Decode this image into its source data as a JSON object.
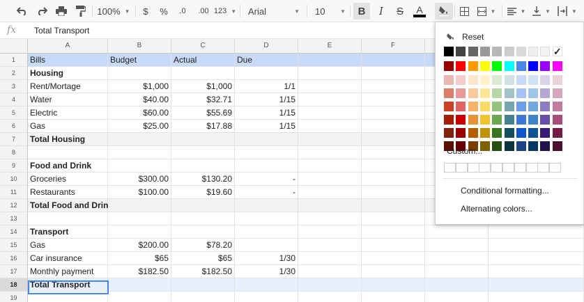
{
  "toolbar": {
    "zoom": "100%",
    "currency": "$",
    "percent": "%",
    "decrease_decimal": ".0",
    "increase_decimal": ".00",
    "number_format": "123",
    "font": "Arial",
    "font_size": "10",
    "bold": "B",
    "italic": "I",
    "strikethrough": "S",
    "text_color": "A",
    "text_color_value": "#000000",
    "icons": [
      "undo-icon",
      "redo-icon",
      "print-icon",
      "paint-format-icon",
      "fill-color-icon",
      "borders-icon",
      "merge-cells-icon",
      "horizontal-align-icon",
      "vertical-align-icon",
      "text-rotation-icon"
    ]
  },
  "formula_bar": {
    "fx": "fx",
    "value": "Total Transport"
  },
  "columns": [
    "A",
    "B",
    "C",
    "D",
    "E",
    "F"
  ],
  "rows": [
    {
      "num": "1",
      "style": "hdr",
      "cells": [
        "Bills",
        "Budget",
        "Actual",
        "Due",
        "",
        ""
      ]
    },
    {
      "num": "2",
      "style": "",
      "cells": [
        "Housing",
        "",
        "",
        "",
        "",
        ""
      ],
      "bold_first": true
    },
    {
      "num": "3",
      "style": "",
      "cells": [
        "Rent/Mortage",
        "$1,000",
        "$1,000",
        "1/1",
        "",
        ""
      ]
    },
    {
      "num": "4",
      "style": "",
      "cells": [
        "Water",
        "$40.00",
        "$32.71",
        "1/15",
        "",
        ""
      ]
    },
    {
      "num": "5",
      "style": "",
      "cells": [
        "Electric",
        "$60.00",
        "$55.69",
        "1/15",
        "",
        ""
      ]
    },
    {
      "num": "6",
      "style": "",
      "cells": [
        "Gas",
        "$25.00",
        "$17.88",
        "1/15",
        "",
        ""
      ]
    },
    {
      "num": "7",
      "style": "tot",
      "cells": [
        "Total Housing",
        "",
        "",
        "",
        "",
        ""
      ],
      "bold_first": true
    },
    {
      "num": "8",
      "style": "",
      "cells": [
        "",
        "",
        "",
        "",
        "",
        ""
      ]
    },
    {
      "num": "9",
      "style": "",
      "cells": [
        "Food and Drink",
        "",
        "",
        "",
        "",
        ""
      ],
      "bold_first": true
    },
    {
      "num": "10",
      "style": "",
      "cells": [
        "Groceries",
        "$300.00",
        "$130.20",
        "-",
        "",
        ""
      ]
    },
    {
      "num": "11",
      "style": "",
      "cells": [
        "Restaurants",
        "$100.00",
        "$19.60",
        "-",
        "",
        ""
      ]
    },
    {
      "num": "12",
      "style": "tot",
      "cells": [
        "Total Food and Drink",
        "",
        "",
        "",
        "",
        ""
      ],
      "bold_first": true
    },
    {
      "num": "13",
      "style": "",
      "cells": [
        "",
        "",
        "",
        "",
        "",
        ""
      ]
    },
    {
      "num": "14",
      "style": "",
      "cells": [
        "Transport",
        "",
        "",
        "",
        "",
        ""
      ],
      "bold_first": true
    },
    {
      "num": "15",
      "style": "",
      "cells": [
        "Gas",
        "$200.00",
        "$78.20",
        "",
        "",
        ""
      ]
    },
    {
      "num": "16",
      "style": "",
      "cells": [
        "Car insurance",
        "$65",
        "$65",
        "1/30",
        "",
        ""
      ]
    },
    {
      "num": "17",
      "style": "",
      "cells": [
        "Monthly payment",
        "$182.50",
        "$182.50",
        "1/30",
        "",
        ""
      ]
    },
    {
      "num": "18",
      "style": "sel",
      "cells": [
        "Total Transport",
        "",
        "",
        "",
        "",
        ""
      ],
      "bold_first": true
    },
    {
      "num": "19",
      "style": "",
      "cells": [
        "",
        "",
        "",
        "",
        "",
        ""
      ]
    }
  ],
  "fill_popup": {
    "reset_label": "Reset",
    "custom_label": "Custom...",
    "conditional_formatting": "Conditional formatting...",
    "alternating_colors": "Alternating colors...",
    "selected_swatch": "#ffffff",
    "grays": [
      "#000000",
      "#434343",
      "#666666",
      "#999999",
      "#b7b7b7",
      "#cccccc",
      "#d9d9d9",
      "#efefef",
      "#f3f3f3",
      "#ffffff"
    ],
    "brights": [
      "#980000",
      "#ff0000",
      "#ff9900",
      "#ffff00",
      "#00ff00",
      "#00ffff",
      "#4a86e8",
      "#0000ff",
      "#9900ff",
      "#ff00ff"
    ],
    "shades": [
      [
        "#e6b8af",
        "#f4cccc",
        "#fce5cd",
        "#fff2cc",
        "#d9ead3",
        "#d0e0e3",
        "#c9daf8",
        "#cfe2f3",
        "#d9d2e9",
        "#ead1dc"
      ],
      [
        "#dd7e6b",
        "#ea9999",
        "#f9cb9c",
        "#ffe599",
        "#b6d7a8",
        "#a2c4c9",
        "#a4c2f4",
        "#9fc5e8",
        "#b4a7d6",
        "#d5a6bd"
      ],
      [
        "#cc4125",
        "#e06666",
        "#f6b26b",
        "#ffd966",
        "#93c47d",
        "#76a5af",
        "#6d9eeb",
        "#6fa8dc",
        "#8e7cc3",
        "#c27ba0"
      ],
      [
        "#a61c00",
        "#cc0000",
        "#e69138",
        "#f1c232",
        "#6aa84f",
        "#45818e",
        "#3c78d8",
        "#3d85c6",
        "#674ea7",
        "#a64d79"
      ],
      [
        "#85200c",
        "#990000",
        "#b45f06",
        "#bf9000",
        "#38761d",
        "#134f5c",
        "#1155cc",
        "#0b5394",
        "#351c75",
        "#741b47"
      ],
      [
        "#5b0f00",
        "#660000",
        "#783f04",
        "#7f6000",
        "#274e13",
        "#0c343d",
        "#1c4587",
        "#073763",
        "#20124d",
        "#4c1130"
      ]
    ]
  }
}
